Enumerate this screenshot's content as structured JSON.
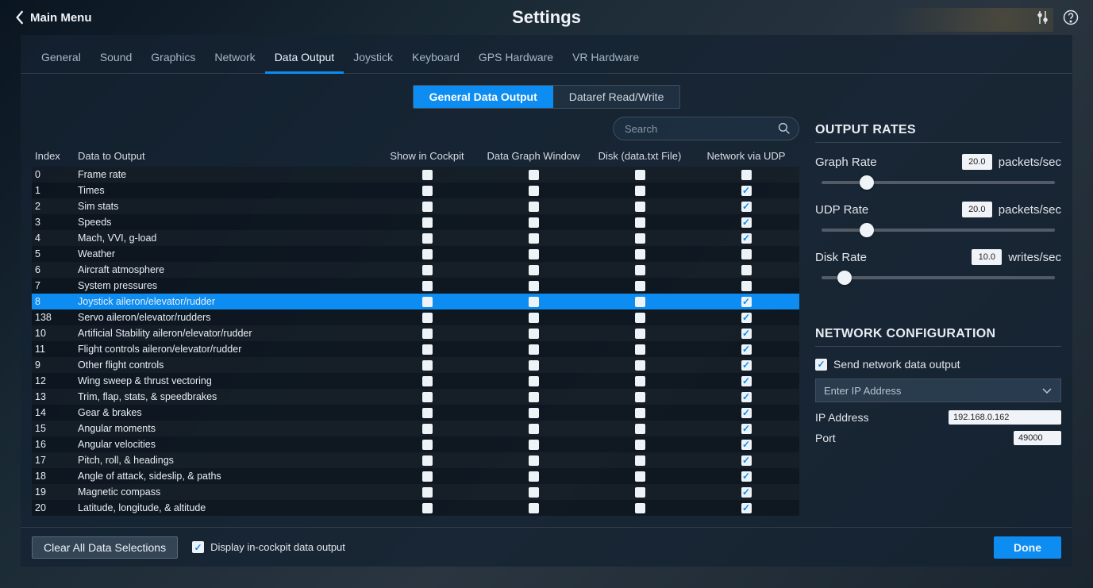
{
  "header": {
    "back_label": "Main Menu",
    "title": "Settings"
  },
  "tabs": [
    "General",
    "Sound",
    "Graphics",
    "Network",
    "Data Output",
    "Joystick",
    "Keyboard",
    "GPS Hardware",
    "VR Hardware"
  ],
  "active_tab": 4,
  "subtabs": [
    "General Data Output",
    "Dataref Read/Write"
  ],
  "active_subtab": 0,
  "search": {
    "placeholder": "Search"
  },
  "grid": {
    "headers": {
      "index": "Index",
      "name": "Data to Output",
      "c1": "Show in Cockpit",
      "c2": "Data Graph Window",
      "c3": "Disk (data.txt File)",
      "c4": "Network via UDP"
    },
    "rows": [
      {
        "idx": "0",
        "name": "Frame rate",
        "c1": false,
        "c2": false,
        "c3": false,
        "c4": false,
        "sel": false
      },
      {
        "idx": "1",
        "name": "Times",
        "c1": false,
        "c2": false,
        "c3": false,
        "c4": true,
        "sel": false
      },
      {
        "idx": "2",
        "name": "Sim stats",
        "c1": false,
        "c2": false,
        "c3": false,
        "c4": true,
        "sel": false
      },
      {
        "idx": "3",
        "name": "Speeds",
        "c1": false,
        "c2": false,
        "c3": false,
        "c4": true,
        "sel": false
      },
      {
        "idx": "4",
        "name": "Mach, VVI, g-load",
        "c1": false,
        "c2": false,
        "c3": false,
        "c4": true,
        "sel": false
      },
      {
        "idx": "5",
        "name": "Weather",
        "c1": false,
        "c2": false,
        "c3": false,
        "c4": false,
        "sel": false
      },
      {
        "idx": "6",
        "name": "Aircraft atmosphere",
        "c1": false,
        "c2": false,
        "c3": false,
        "c4": false,
        "sel": false
      },
      {
        "idx": "7",
        "name": "System pressures",
        "c1": false,
        "c2": false,
        "c3": false,
        "c4": false,
        "sel": false
      },
      {
        "idx": "8",
        "name": "Joystick aileron/elevator/rudder",
        "c1": false,
        "c2": false,
        "c3": false,
        "c4": true,
        "sel": true
      },
      {
        "idx": "138",
        "name": "Servo aileron/elevator/rudders",
        "c1": false,
        "c2": false,
        "c3": false,
        "c4": true,
        "sel": false
      },
      {
        "idx": "10",
        "name": "Artificial Stability aileron/elevator/rudder",
        "c1": false,
        "c2": false,
        "c3": false,
        "c4": true,
        "sel": false
      },
      {
        "idx": "11",
        "name": "Flight controls aileron/elevator/rudder",
        "c1": false,
        "c2": false,
        "c3": false,
        "c4": true,
        "sel": false
      },
      {
        "idx": "9",
        "name": "Other flight controls",
        "c1": false,
        "c2": false,
        "c3": false,
        "c4": true,
        "sel": false
      },
      {
        "idx": "12",
        "name": "Wing sweep & thrust vectoring",
        "c1": false,
        "c2": false,
        "c3": false,
        "c4": true,
        "sel": false
      },
      {
        "idx": "13",
        "name": "Trim, flap, stats, & speedbrakes",
        "c1": false,
        "c2": false,
        "c3": false,
        "c4": true,
        "sel": false
      },
      {
        "idx": "14",
        "name": "Gear & brakes",
        "c1": false,
        "c2": false,
        "c3": false,
        "c4": true,
        "sel": false
      },
      {
        "idx": "15",
        "name": "Angular moments",
        "c1": false,
        "c2": false,
        "c3": false,
        "c4": true,
        "sel": false
      },
      {
        "idx": "16",
        "name": "Angular velocities",
        "c1": false,
        "c2": false,
        "c3": false,
        "c4": true,
        "sel": false
      },
      {
        "idx": "17",
        "name": "Pitch, roll, & headings",
        "c1": false,
        "c2": false,
        "c3": false,
        "c4": true,
        "sel": false
      },
      {
        "idx": "18",
        "name": "Angle of attack, sideslip, & paths",
        "c1": false,
        "c2": false,
        "c3": false,
        "c4": true,
        "sel": false
      },
      {
        "idx": "19",
        "name": "Magnetic compass",
        "c1": false,
        "c2": false,
        "c3": false,
        "c4": true,
        "sel": false
      },
      {
        "idx": "20",
        "name": "Latitude, longitude, & altitude",
        "c1": false,
        "c2": false,
        "c3": false,
        "c4": true,
        "sel": false
      }
    ]
  },
  "rates": {
    "title": "OUTPUT RATES",
    "graph": {
      "label": "Graph Rate",
      "value": "20.0",
      "unit": "packets/sec",
      "pos": 18
    },
    "udp": {
      "label": "UDP Rate",
      "value": "20.0",
      "unit": "packets/sec",
      "pos": 18
    },
    "disk": {
      "label": "Disk Rate",
      "value": "10.0",
      "unit": "writes/sec",
      "pos": 9
    }
  },
  "net": {
    "title": "NETWORK CONFIGURATION",
    "send_label": "Send network data output",
    "send_checked": true,
    "dropdown_placeholder": "Enter IP Address",
    "ip_label": "IP Address",
    "ip_value": "192.168.0.162",
    "port_label": "Port",
    "port_value": "49000"
  },
  "footer": {
    "clear_label": "Clear All Data Selections",
    "display_label": "Display in-cockpit data output",
    "display_checked": true,
    "done_label": "Done"
  }
}
